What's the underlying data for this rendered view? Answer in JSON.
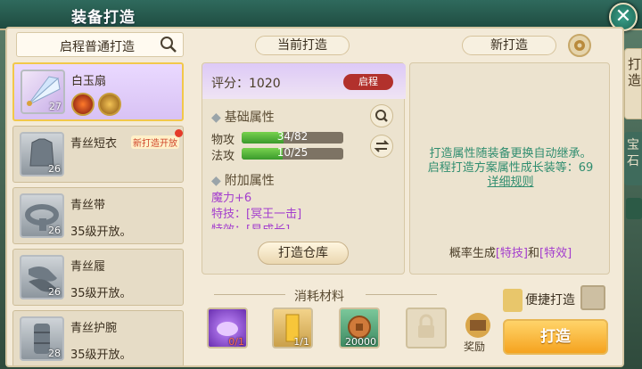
{
  "window": {
    "title": "装备打造",
    "close_icon": "close-icon"
  },
  "side_tabs": {
    "tab1": "打造",
    "tab2": "宝石"
  },
  "search": {
    "label": "启程普通打造",
    "icon": "search-icon"
  },
  "items": [
    {
      "name": "白玉扇",
      "level": "27",
      "selected": true
    },
    {
      "name": "青丝短衣",
      "level": "26",
      "badge": "新打造开放"
    },
    {
      "name": "青丝带",
      "level": "26",
      "status": "35级开放。"
    },
    {
      "name": "青丝履",
      "level": "26",
      "status": "35级开放。"
    },
    {
      "name": "青丝护腕",
      "level": "28",
      "status": "35级开放。"
    }
  ],
  "current": {
    "header": "当前打造",
    "score_label": "评分：",
    "score": "1020",
    "quality": "启程",
    "base_section": "基础属性",
    "attrs": [
      {
        "label": "物攻",
        "value": "34/82",
        "fraction": 0.415
      },
      {
        "label": "法攻",
        "value": "10/25",
        "fraction": 0.4
      }
    ],
    "extra_section": "附加属性",
    "extras": [
      "魔力+6",
      "特技：[冥王一击]",
      "特效：[易成长]"
    ],
    "store_button": "打造仓库"
  },
  "new": {
    "header": "新打造",
    "line1": "打造属性随装备更换自动继承。",
    "line2": "启程打造方案属性成长装等：69",
    "rule_link": "详细规则",
    "prob_prefix": "概率生成",
    "prob_t1": "[特技]",
    "prob_mid": "和",
    "prob_t2": "[特效]"
  },
  "materials": {
    "header": "消耗材料",
    "list": [
      {
        "name": "purple-crystal-icon",
        "count": "0/1"
      },
      {
        "name": "yellow-scroll-icon",
        "count": "1/1"
      },
      {
        "name": "coin-icon",
        "count": "20000"
      },
      {
        "name": "lock-icon",
        "count": ""
      }
    ],
    "reward": "奖励"
  },
  "quick_forge": "便捷打造",
  "forge_button": "打造",
  "colors": {
    "accent": "#f5a31f",
    "title_bar": "#2f6a5d",
    "purple": "#a33dce",
    "teal_text": "#2f8d6f"
  }
}
